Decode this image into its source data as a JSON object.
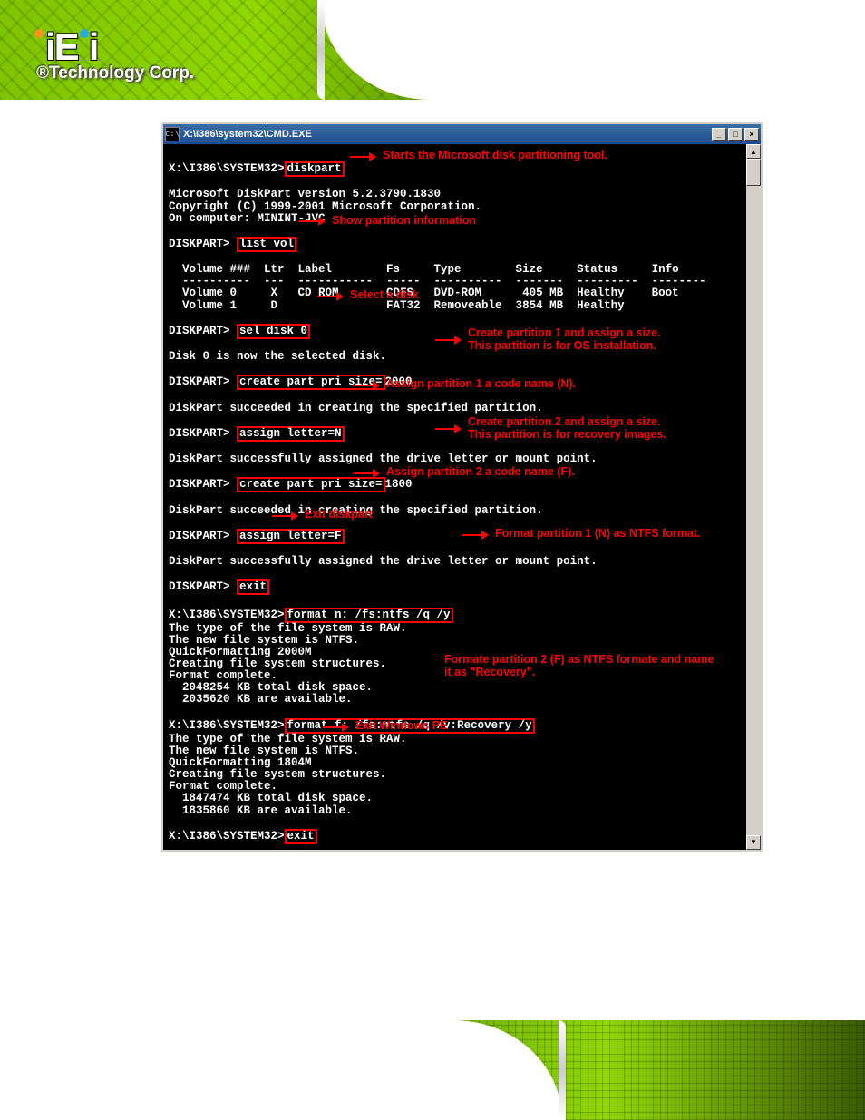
{
  "logo": {
    "brand": "iEi",
    "tagline": "®Technology Corp."
  },
  "window": {
    "title": "X:\\I386\\system32\\CMD.EXE",
    "icon_label": "c:\\"
  },
  "console": {
    "prompt_sys": "X:\\I386\\SYSTEM32>",
    "prompt_dp": "DISKPART> ",
    "cmd_diskpart": "diskpart",
    "header1": "Microsoft DiskPart version 5.2.3790.1830",
    "header2": "Copyright (C) 1999-2001 Microsoft Corporation.",
    "header3": "On computer: MININT-JVC",
    "cmd_listvol": "list vol",
    "table_hdr": "  Volume ###  Ltr  Label        Fs     Type        Size     Status     Info",
    "table_sep": "  ----------  ---  -----------  -----  ----------  -------  ---------  --------",
    "table_row0": "  Volume 0     X   CD_ROM       CDFS   DVD-ROM      405 MB  Healthy    Boot",
    "table_row1": "  Volume 1     D                FAT32  Removeable  3854 MB  Healthy",
    "cmd_seldisk": "sel disk 0",
    "resp_seldisk": "Disk 0 is now the selected disk.",
    "cmd_create1_a": "create part pri size=",
    "cmd_create1_b": "2000",
    "resp_create": "DiskPart succeeded in creating the specified partition.",
    "cmd_assignN": "assign letter=N",
    "resp_assign": "DiskPart successfully assigned the drive letter or mount point.",
    "cmd_create2_a": "create part pri size=",
    "cmd_create2_b": "1800",
    "cmd_assignF": "assign letter=F",
    "cmd_exit": "exit",
    "cmd_formatN": "format n: /fs:ntfs /q /y",
    "formatN_out1": "The type of the file system is RAW.",
    "formatN_out2": "The new file system is NTFS.",
    "formatN_out3": "QuickFormatting 2000M",
    "formatN_out4": "Creating file system structures.",
    "formatN_out5": "Format complete.",
    "formatN_out6": "  2048254 KB total disk space.",
    "formatN_out7": "  2035620 KB are available.",
    "cmd_formatF": "format f: /fs:ntfs /q /v:Recovery /y",
    "formatF_out1": "The type of the file system is RAW.",
    "formatF_out2": "The new file system is NTFS.",
    "formatF_out3": "QuickFormatting 1804M",
    "formatF_out4": "Creating file system structures.",
    "formatF_out5": "Format complete.",
    "formatF_out6": "  1847474 KB total disk space.",
    "formatF_out7": "  1835860 KB are available.",
    "cmd_exit2": "exit"
  },
  "annotations": {
    "diskpart": "Starts the Microsoft disk partitioning tool.",
    "listvol": "Show partition information",
    "seldisk": "Select a disk",
    "create1": "Create partition 1 and assign a size.\nThis partition is for OS installation.",
    "assignN": "Assign partition 1 a code name (N).",
    "create2": "Create partition 2 and assign a size.\nThis partition is for recovery images.",
    "assignF": "Assign partition 2 a code name (F).",
    "exitdp": "Exit diskpart",
    "formatN": "Format partition 1 (N) as NTFS format.",
    "formatF": "Formate partition 2 (F) as NTFS formate and name it as \"Recovery\".",
    "exitpe": "Exit Windows PE"
  }
}
